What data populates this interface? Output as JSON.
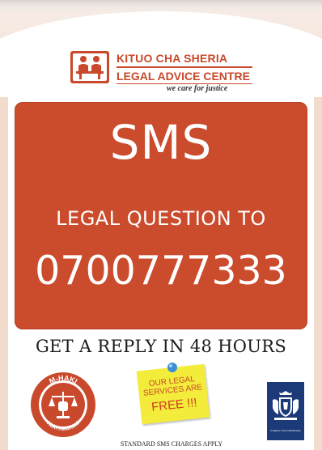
{
  "logo": {
    "title": "KITUO CHA SHERIA",
    "subtitle": "LEGAL ADVICE CENTRE",
    "tagline": "we care for justice",
    "icon": "people-at-table-icon",
    "color": "#c8492b"
  },
  "panel": {
    "headline": "SMS",
    "question": "LEGAL QUESTION TO",
    "phone_number": "0700777333",
    "background_color": "#cb4b2d"
  },
  "reply_text": "GET A REPLY IN 48 HOURS",
  "mhaki": {
    "top_label": "M-HAKI",
    "bottom_label": "Haki mkononi",
    "icon": "scales-fist-icon",
    "color": "#c8492b"
  },
  "sticky_note": {
    "line": "OUR LEGAL SERVICES ARE",
    "free": "FREE !!!",
    "color": "#f3ec3a"
  },
  "charges_note": "STANDARD SMS CHARGES APPLY",
  "crest": {
    "icon": "netherlands-coat-of-arms-icon",
    "caption": "Kingdom of the Netherlands",
    "color": "#1c3a78"
  }
}
